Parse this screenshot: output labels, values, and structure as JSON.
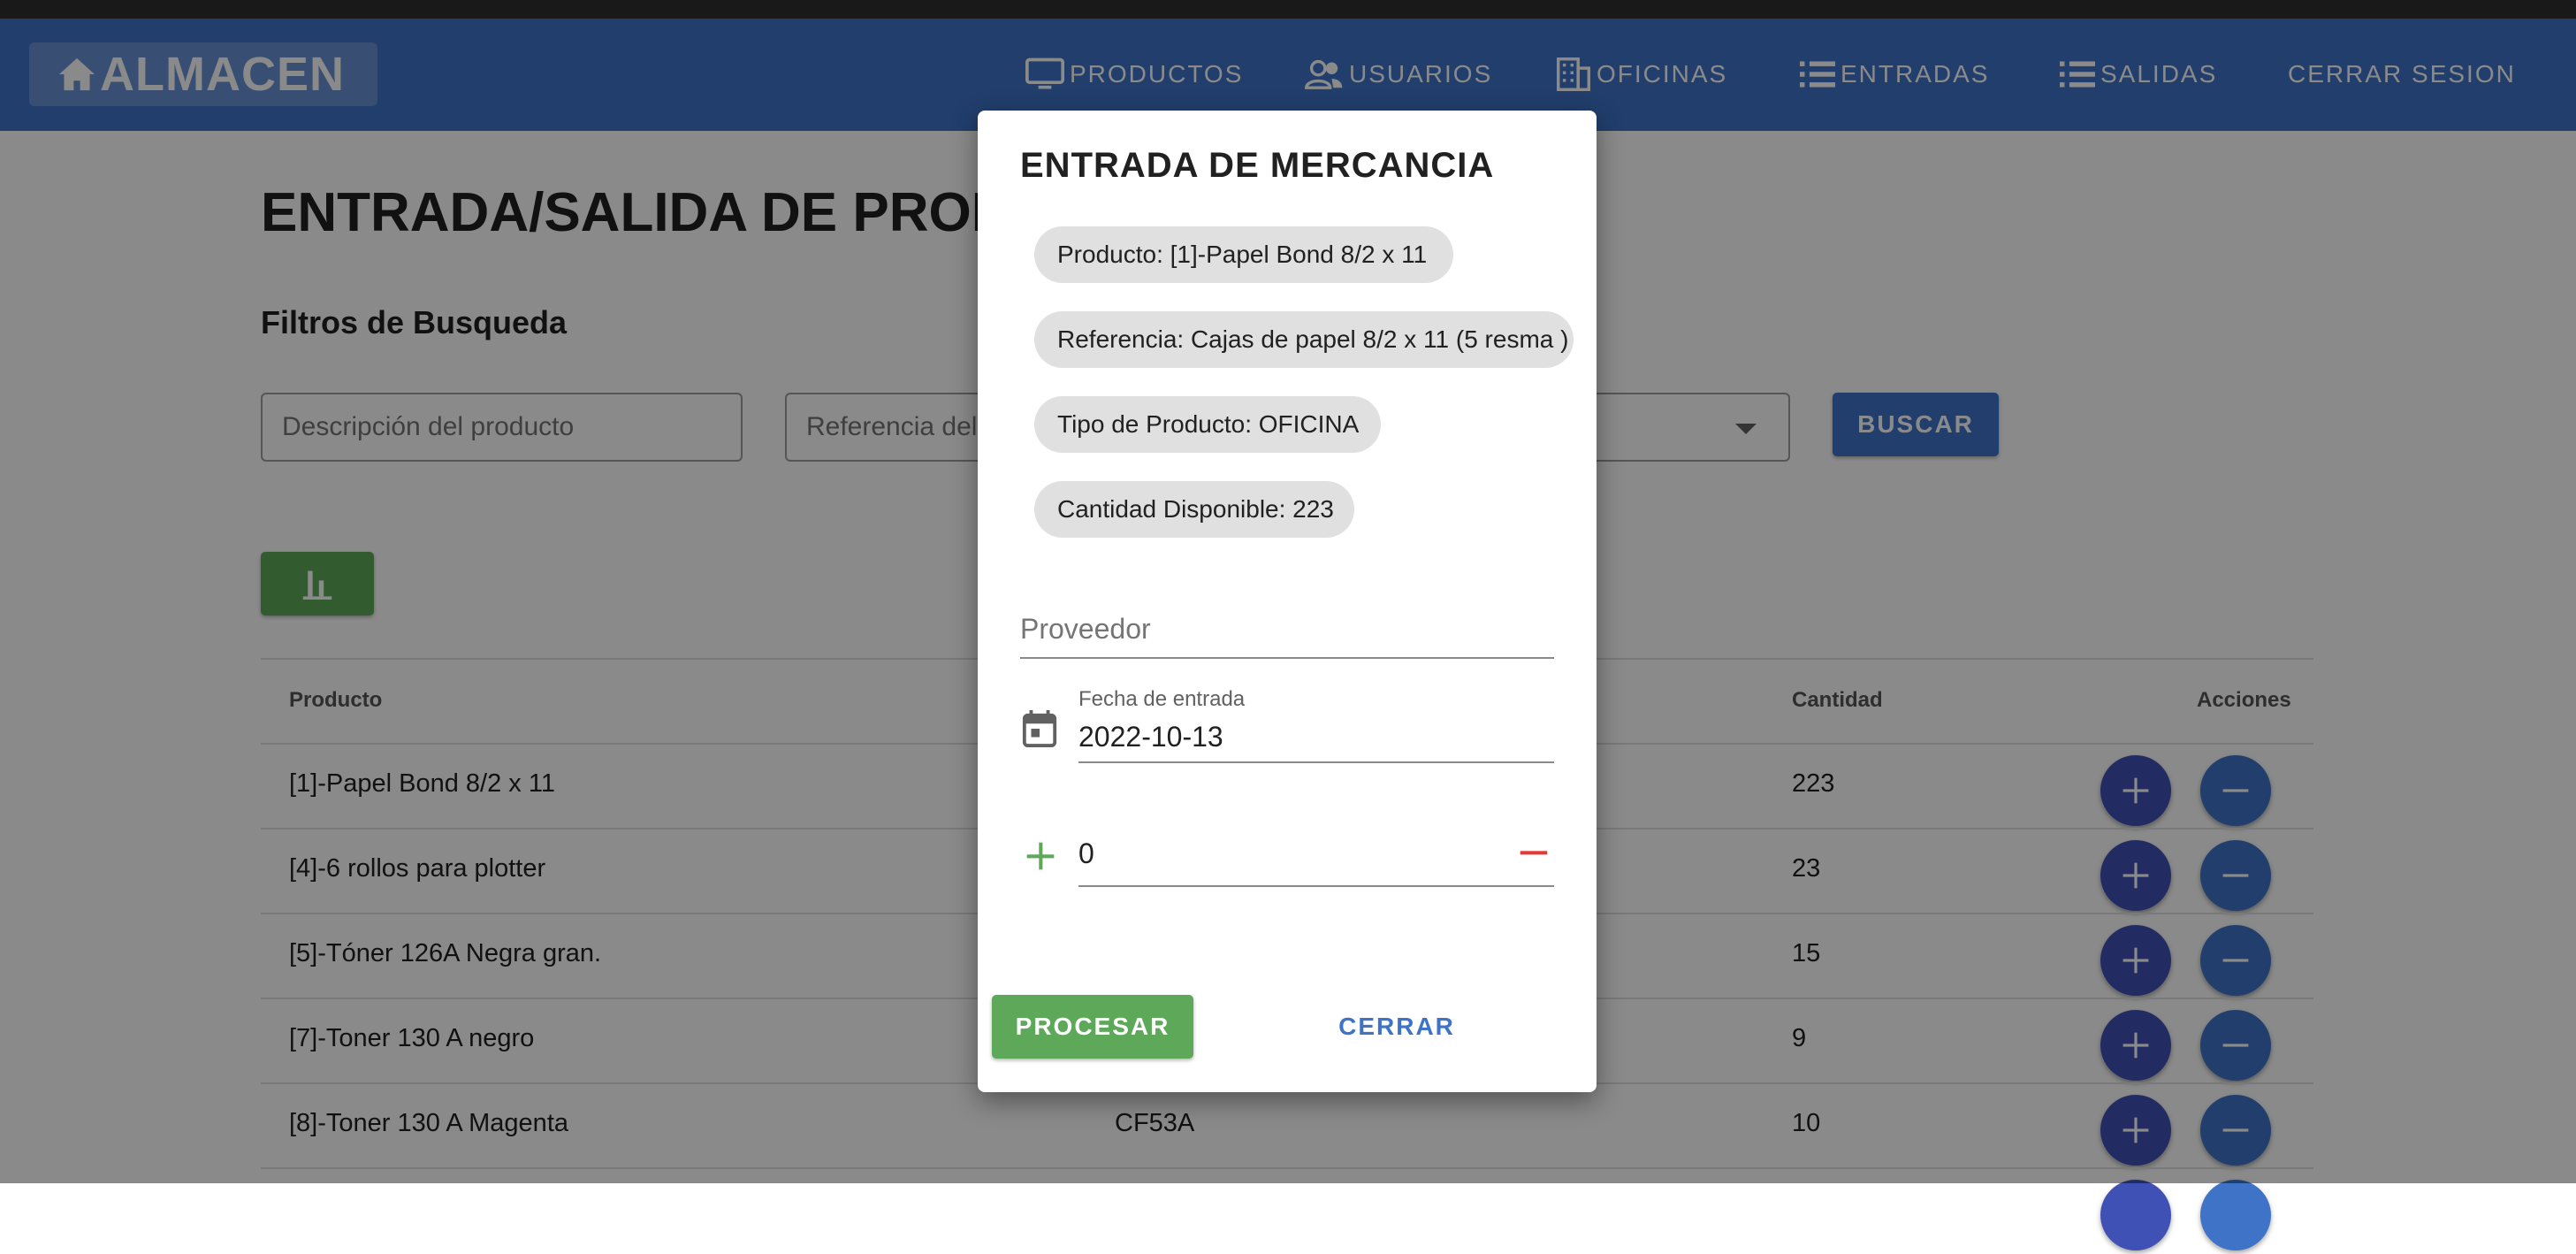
{
  "app": {
    "brand": "ALMACEN"
  },
  "nav": {
    "productos": "PRODUCTOS",
    "usuarios": "USUARIOS",
    "oficinas": "OFICINAS",
    "entradas": "ENTRADAS",
    "salidas": "SALIDAS",
    "cerrar_sesion": "CERRAR SESION"
  },
  "page": {
    "title": "ENTRADA/SALIDA DE PRODUCTOS",
    "filters_title": "Filtros de Busqueda",
    "search_placeholder": "Descripción del producto",
    "reference_placeholder": "Referencia del producto",
    "search_button": "BUSCAR"
  },
  "table": {
    "headers": {
      "producto": "Producto",
      "cantidad": "Cantidad",
      "acciones": "Acciones"
    },
    "rows": [
      {
        "producto": "[1]-Papel Bond 8/2 x 11",
        "referencia": "",
        "cantidad": "223"
      },
      {
        "producto": "[4]-6 rollos para plotter",
        "referencia": "",
        "cantidad": "23"
      },
      {
        "producto": "[5]-Tóner 126A Negra gran.",
        "referencia": "",
        "cantidad": "15"
      },
      {
        "producto": "[7]-Toner 130 A negro",
        "referencia": "",
        "cantidad": "9"
      },
      {
        "producto": "[8]-Toner 130 A Magenta",
        "referencia": "CF53A",
        "cantidad": "10"
      }
    ]
  },
  "dialog": {
    "title": "ENTRADA DE MERCANCIA",
    "chips": [
      "Producto: [1]-Papel Bond 8/2 x 11",
      "Referencia: Cajas de papel 8/2 x 11 (5 resma )",
      "Tipo de Producto: OFICINA",
      "Cantidad Disponible: 223"
    ],
    "proveedor_placeholder": "Proveedor",
    "fecha_label": "Fecha de entrada",
    "fecha_value": "2022-10-13",
    "cantidad_value": "0",
    "procesar": "PROCESAR",
    "cerrar": "CERRAR"
  },
  "colors": {
    "primary": "#3e73c8",
    "success": "#5ea85a",
    "fab_add": "#3f51b5",
    "danger": "#e53935"
  }
}
